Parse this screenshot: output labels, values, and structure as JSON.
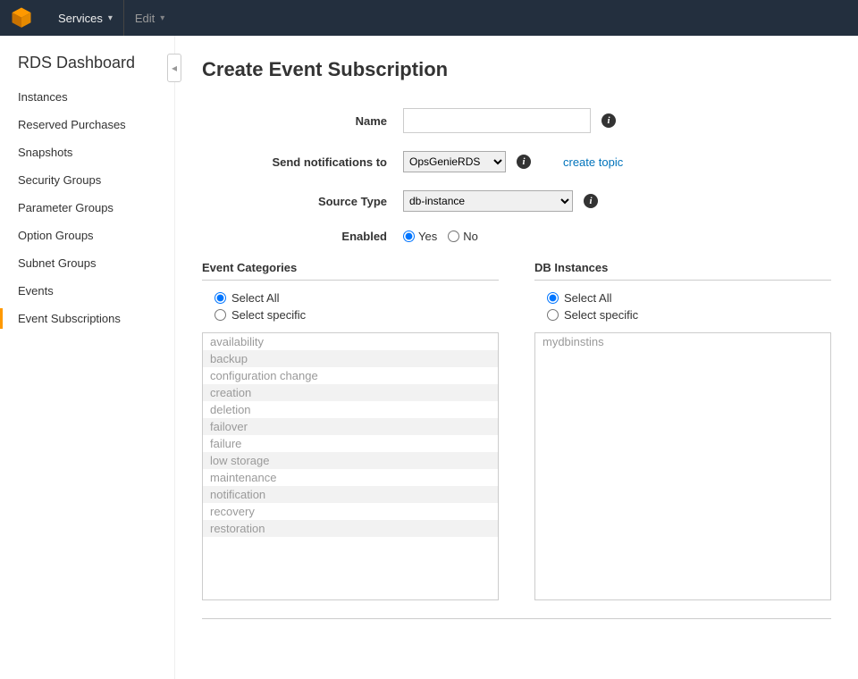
{
  "topbar": {
    "services_label": "Services",
    "edit_label": "Edit"
  },
  "sidebar": {
    "title": "RDS Dashboard",
    "items": [
      "Instances",
      "Reserved Purchases",
      "Snapshots",
      "Security Groups",
      "Parameter Groups",
      "Option Groups",
      "Subnet Groups",
      "Events",
      "Event Subscriptions"
    ],
    "active_index": 8
  },
  "page": {
    "title": "Create Event Subscription"
  },
  "form": {
    "name_label": "Name",
    "name_value": "",
    "notify_label": "Send notifications to",
    "notify_value": "OpsGenieRDS",
    "create_topic_link": "create topic",
    "source_type_label": "Source Type",
    "source_type_value": "db-instance",
    "enabled_label": "Enabled",
    "yes_label": "Yes",
    "no_label": "No",
    "enabled_value": "Yes"
  },
  "categories": {
    "title": "Event Categories",
    "select_all_label": "Select All",
    "select_specific_label": "Select specific",
    "mode": "Select All",
    "items": [
      "availability",
      "backup",
      "configuration change",
      "creation",
      "deletion",
      "failover",
      "failure",
      "low storage",
      "maintenance",
      "notification",
      "recovery",
      "restoration"
    ]
  },
  "instances": {
    "title": "DB Instances",
    "select_all_label": "Select All",
    "select_specific_label": "Select specific",
    "mode": "Select All",
    "items": [
      "mydbinstins"
    ]
  }
}
